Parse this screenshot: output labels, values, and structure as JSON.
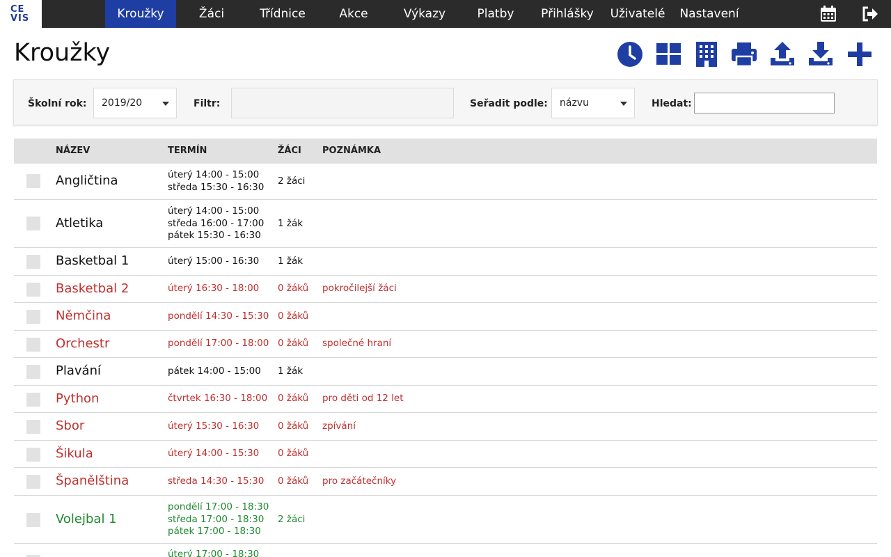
{
  "nav": {
    "logo_line1": "CE",
    "logo_line2": "VIS",
    "items": [
      {
        "label": "Kroužky",
        "active": true
      },
      {
        "label": "Žáci"
      },
      {
        "label": "Třídnice"
      },
      {
        "label": "Akce"
      },
      {
        "label": "Výkazy"
      },
      {
        "label": "Platby"
      },
      {
        "label": "Přihlášky"
      },
      {
        "label": "Uživatelé"
      },
      {
        "label": "Nastavení"
      }
    ],
    "icons": [
      "calendar-icon",
      "logout-icon"
    ]
  },
  "page": {
    "title": "Kroužky",
    "toolbar_icons": [
      "clock-icon",
      "grid-icon",
      "building-icon",
      "print-icon",
      "upload-icon",
      "download-icon",
      "plus-icon"
    ],
    "accent": "#1f3ea3"
  },
  "filters": {
    "school_year_label": "Školní rok:",
    "school_year_value": "2019/20",
    "filter_label": "Filtr:",
    "filter_value": "",
    "sort_label": "Seřadit podle:",
    "sort_value": "názvu",
    "search_label": "Hledat:",
    "search_value": ""
  },
  "table": {
    "columns": [
      "NÁZEV",
      "TERMÍN",
      "ŽÁCI",
      "POZNÁMKA"
    ],
    "status_colors": {
      "black": "#111111",
      "red": "#c0302e",
      "green": "#1f8a2e"
    },
    "rows": [
      {
        "name": "Angličtina",
        "times": [
          "úterý 14:00 - 15:00",
          "středa 15:30 - 16:30"
        ],
        "count": "2 žáci",
        "note": "",
        "color": "black"
      },
      {
        "name": "Atletika",
        "times": [
          "úterý 14:00 - 15:00",
          "středa 16:00 - 17:00",
          "pátek 15:30 - 16:30"
        ],
        "count": "1 žák",
        "note": "",
        "color": "black"
      },
      {
        "name": "Basketbal 1",
        "times": [
          "úterý 15:00 - 16:30"
        ],
        "count": "1 žák",
        "note": "",
        "color": "black"
      },
      {
        "name": "Basketbal 2",
        "times": [
          "úterý 16:30 - 18:00"
        ],
        "count": "0 žáků",
        "note": "pokročilejší žáci",
        "color": "red"
      },
      {
        "name": "Němčina",
        "times": [
          "pondělí 14:30 - 15:30"
        ],
        "count": "0 žáků",
        "note": "",
        "color": "red"
      },
      {
        "name": "Orchestr",
        "times": [
          "pondělí 17:00 - 18:00"
        ],
        "count": "0 žáků",
        "note": "společné hraní",
        "color": "red"
      },
      {
        "name": "Plavání",
        "times": [
          "pátek 14:00 - 15:00"
        ],
        "count": "1 žák",
        "note": "",
        "color": "black"
      },
      {
        "name": "Python",
        "times": [
          "čtvrtek 16:30 - 18:00"
        ],
        "count": "0 žáků",
        "note": "pro děti od 12 let",
        "color": "red"
      },
      {
        "name": "Sbor",
        "times": [
          "úterý 15:30 - 16:30"
        ],
        "count": "0 žáků",
        "note": "zpívání",
        "color": "red"
      },
      {
        "name": "Šikula",
        "times": [
          "úterý 14:00 - 15:30"
        ],
        "count": "0 žáků",
        "note": "",
        "color": "red"
      },
      {
        "name": "Španělština",
        "times": [
          "středa 14:30 - 15:30"
        ],
        "count": "0 žáků",
        "note": "pro začátečníky",
        "color": "red"
      },
      {
        "name": "Volejbal 1",
        "times": [
          "pondělí 17:00 - 18:30",
          "středa 17:00 - 18:30",
          "pátek 17:00 - 18:30"
        ],
        "count": "2 žáci",
        "note": "",
        "color": "green"
      },
      {
        "name": "",
        "times": [
          "úterý 17:00 - 18:30"
        ],
        "count": "",
        "note": "",
        "color": "green"
      }
    ]
  }
}
